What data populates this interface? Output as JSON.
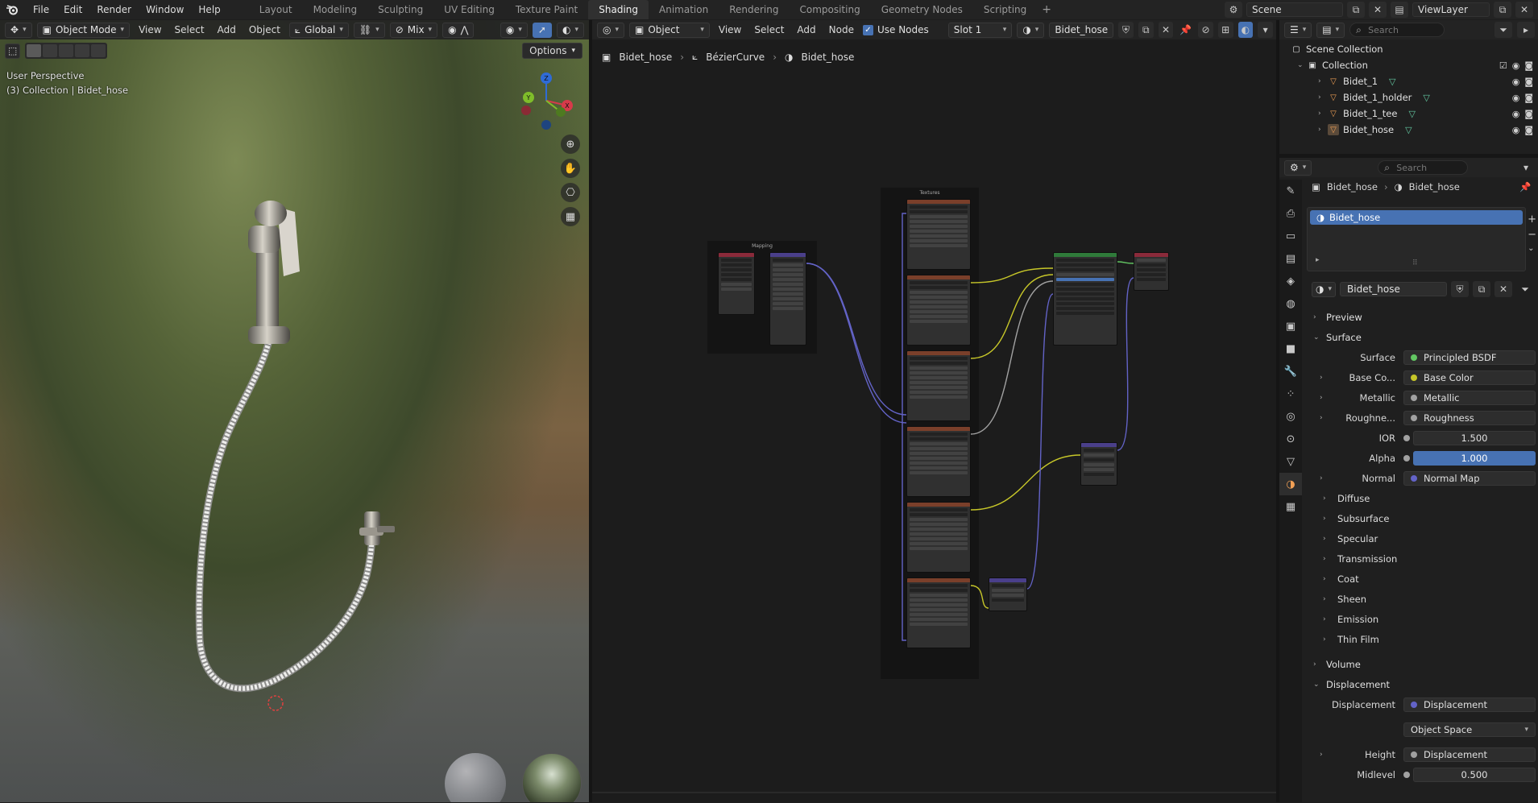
{
  "app": {
    "menu": [
      "File",
      "Edit",
      "Render",
      "Window",
      "Help"
    ],
    "workspaces": [
      "Layout",
      "Modeling",
      "Sculpting",
      "UV Editing",
      "Texture Paint",
      "Shading",
      "Animation",
      "Rendering",
      "Compositing",
      "Geometry Nodes",
      "Scripting"
    ],
    "active_workspace": "Shading",
    "add_workspace": "+",
    "scene": "Scene",
    "view_layer": "ViewLayer"
  },
  "viewport": {
    "mode": "Object Mode",
    "menus": [
      "View",
      "Select",
      "Add",
      "Object"
    ],
    "orientation": "Global",
    "pivot_blend": "Mix",
    "options": "Options",
    "info_line1": "User Perspective",
    "info_line2": "(3) Collection | Bidet_hose",
    "axes": {
      "x": "X",
      "y": "Y",
      "z": "Z"
    }
  },
  "node_editor": {
    "editor_type": "Object",
    "menus": [
      "View",
      "Select",
      "Add",
      "Node"
    ],
    "use_nodes": "Use Nodes",
    "slot": "Slot 1",
    "material": "Bidet_hose",
    "breadcrumb": [
      "Bidet_hose",
      "BézierCurve",
      "Bidet_hose"
    ],
    "frames": {
      "mapping": "Mapping",
      "textures": "Textures"
    }
  },
  "outliner": {
    "search_placeholder": "Search",
    "root": "Scene Collection",
    "collection": "Collection",
    "items": [
      "Bidet_1",
      "Bidet_1_holder",
      "Bidet_1_tee",
      "Bidet_hose"
    ]
  },
  "properties": {
    "search_placeholder": "Search",
    "crumb_object": "Bidet_hose",
    "crumb_material": "Bidet_hose",
    "slot_name": "Bidet_hose",
    "material_name": "Bidet_hose",
    "sections": {
      "preview": "Preview",
      "surface": "Surface",
      "volume": "Volume",
      "displacement": "Displacement"
    },
    "surface_rows": [
      {
        "label": "Surface",
        "value": "Principled BSDF",
        "socket": "g"
      },
      {
        "label": "Base Co...",
        "value": "Base Color",
        "socket": "y",
        "expand": true
      },
      {
        "label": "Metallic",
        "value": "Metallic",
        "socket": "gr",
        "expand": true
      },
      {
        "label": "Roughne...",
        "value": "Roughness",
        "socket": "gr",
        "expand": true
      },
      {
        "label": "IOR",
        "value": "1.500",
        "socket": "gr",
        "num": true
      },
      {
        "label": "Alpha",
        "value": "1.000",
        "socket": "gr",
        "num": true,
        "highlight": true
      },
      {
        "label": "Normal",
        "value": "Normal Map",
        "socket": "p",
        "expand": true
      }
    ],
    "subpanels": [
      "Diffuse",
      "Subsurface",
      "Specular",
      "Transmission",
      "Coat",
      "Sheen",
      "Emission",
      "Thin Film"
    ],
    "displacement_rows": [
      {
        "label": "Displacement",
        "value": "Displacement",
        "socket": "p"
      },
      {
        "label": "",
        "value": "Object Space",
        "socket": ""
      },
      {
        "label": "Height",
        "value": "Displacement",
        "socket": "gr",
        "expand": true
      },
      {
        "label": "Midlevel",
        "value": "0.500",
        "socket": "gr",
        "num": true
      }
    ]
  },
  "colors": {
    "accent": "#4772b3",
    "link_yellow": "#c7c729",
    "link_purple": "#6363c7",
    "link_gray": "#a1a1a1",
    "node_texture_header": "#7a3f2a",
    "node_bsdf_header": "#2f7a3a",
    "node_vector_header": "#4a3f8a"
  }
}
